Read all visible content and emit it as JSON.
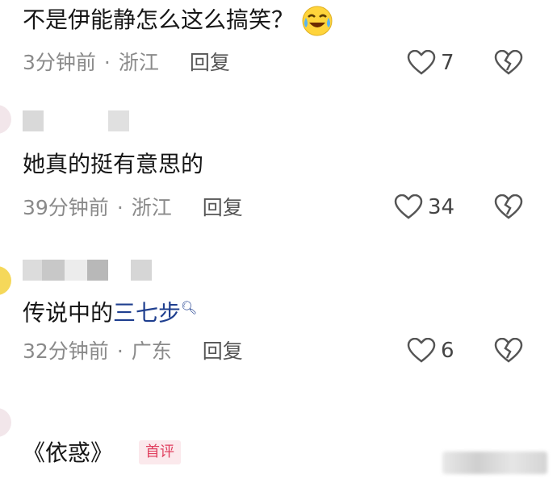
{
  "comments": [
    {
      "text": "不是伊能静怎么这么搞笑？",
      "emoji": "laughing-crying-emoji",
      "time": "3分钟前",
      "location": "浙江",
      "reply": "回复",
      "likes": "7"
    },
    {
      "text": "她真的挺有意思的",
      "time": "39分钟前",
      "location": "浙江",
      "reply": "回复",
      "likes": "34"
    },
    {
      "text_prefix": "传说中的",
      "link": "三七步",
      "time": "32分钟前",
      "location": "广东",
      "reply": "回复",
      "likes": "6"
    },
    {
      "text": "《依惑》",
      "badge": "首评"
    }
  ],
  "separator": "·"
}
